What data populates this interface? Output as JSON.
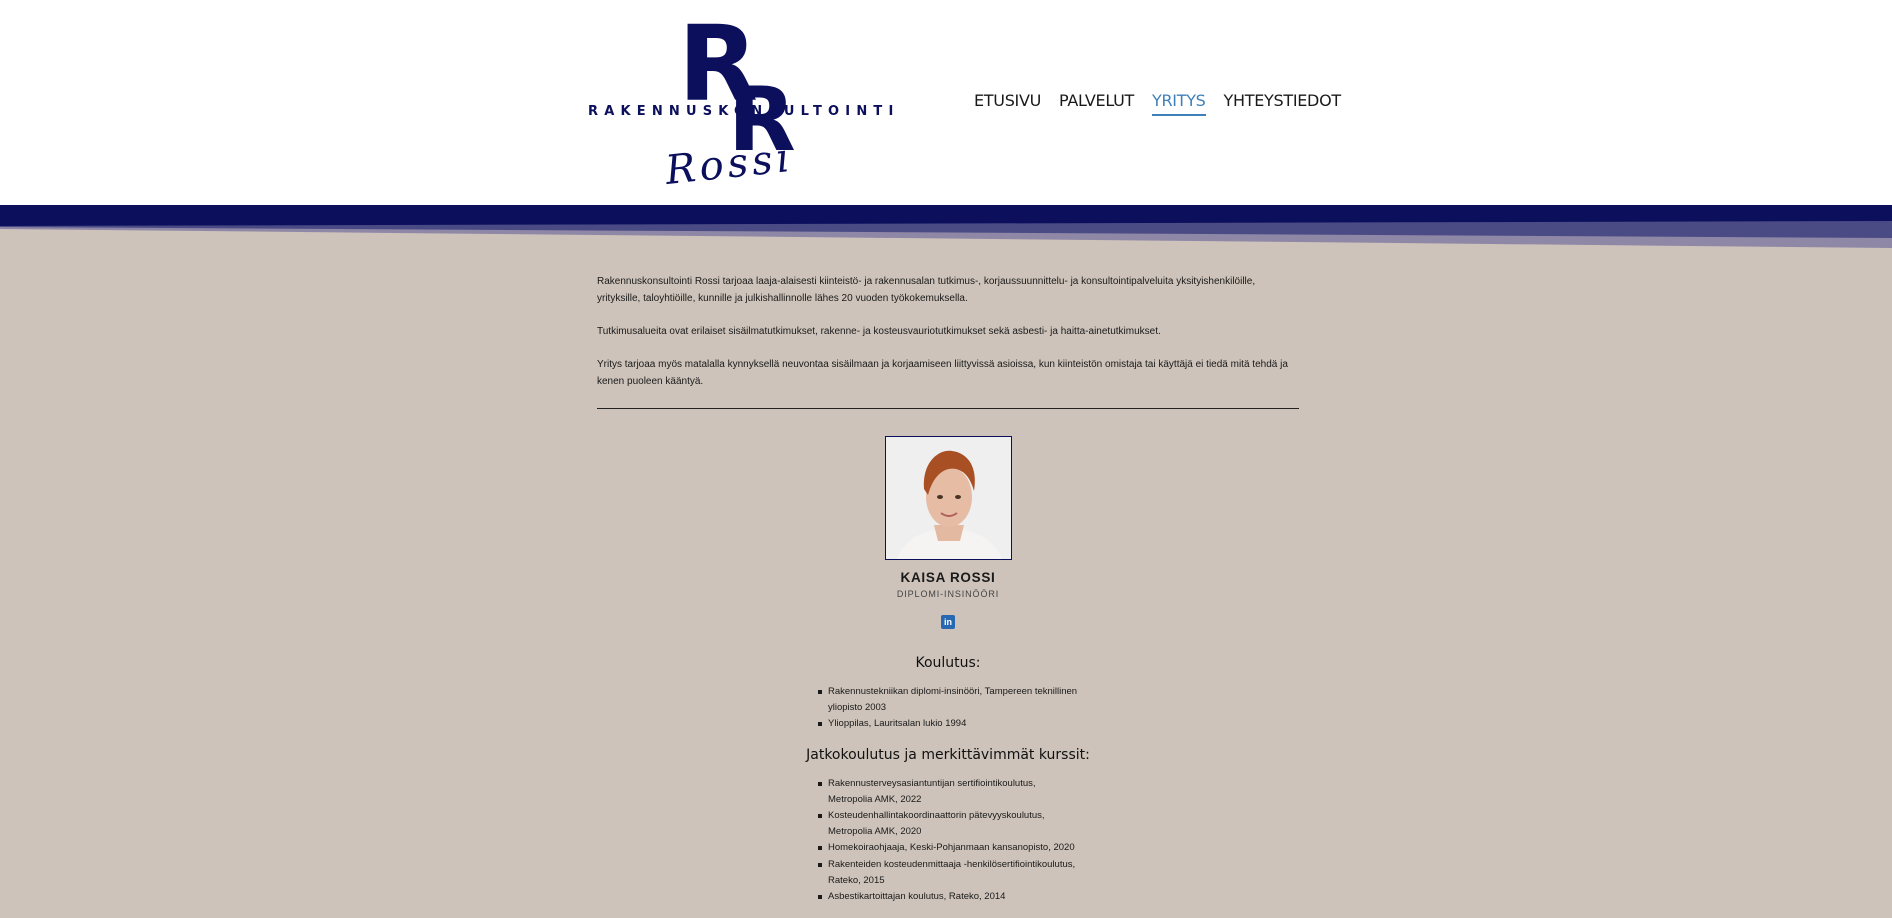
{
  "brand": {
    "letters": "RR",
    "subtitle": "RAKENNUSKONSULTOINTI",
    "signature": "Rossi",
    "colors": {
      "navy": "#0b0f5c",
      "page_bg": "#cdc3ba",
      "accent": "#3f7fba"
    }
  },
  "nav": {
    "items": [
      {
        "label": "ETUSIVU",
        "active": false
      },
      {
        "label": "PALVELUT",
        "active": false
      },
      {
        "label": "YRITYS",
        "active": true
      },
      {
        "label": "YHTEYSTIEDOT",
        "active": false
      }
    ]
  },
  "intro": {
    "paragraphs": [
      "Rakennuskonsultointi Rossi tarjoaa laaja-alaisesti kiinteistö- ja rakennusalan tutkimus-, korjaussuunnittelu- ja konsultointipalveluita yksityishenkilöille, yrityksille, taloyhtiöille, kunnille ja julkishallinnolle lähes 20 vuoden työkokemuksella.",
      "Tutkimusalueita ovat erilaiset sisäilmatutkimukset, rakenne- ja kosteusvauriotutkimukset sekä asbesti- ja haitta-ainetutkimukset.",
      "Yritys tarjoaa myös matalalla kynnyksellä neuvontaa sisäilmaan ja korjaamiseen liittyvissä asioissa, kun kiinteistön omistaja tai käyttäjä ei tiedä mitä tehdä ja kenen puoleen kääntyä."
    ]
  },
  "profile": {
    "name": "KAISA ROSSI",
    "title": "DIPLOMI-INSINÖÖRI",
    "social_icon": "linkedin-icon",
    "education_heading": "Koulutus:",
    "education": [
      "Rakennustekniikan diplomi-insinööri, Tampereen teknillinen yliopisto 2003",
      "Ylioppilas, Lauritsalan lukio 1994"
    ],
    "courses_heading": "Jatkokoulutus ja merkittävimmät kurssit:",
    "courses": [
      "Rakennusterveysasiantuntijan sertifiointikoulutus, Metropolia AMK, 2022",
      "Kosteudenhallintakoordinaattorin pätevyyskoulutus, Metropolia AMK, 2020",
      "Homekoiraohjaaja, Keski-Pohjanmaan kansanopisto, 2020",
      "Rakenteiden kosteudenmittaaja -henkilösertifiointikoulutus, Rateko, 2015",
      "Asbestikartoittajan koulutus, Rateko, 2014"
    ]
  }
}
